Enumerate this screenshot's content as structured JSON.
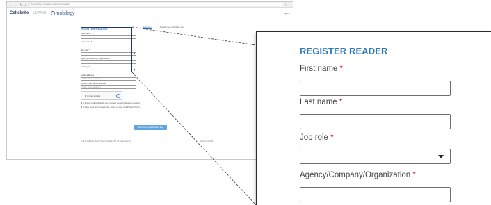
{
  "browser": {
    "url": "Secure  https://celebrite-learn.com/register",
    "nav_back": "←",
    "nav_forward": "→",
    "nav_reload": "C",
    "nav_home": "⌂",
    "tools": "☆ ⋮"
  },
  "site_header": {
    "brand": "Cellebrite",
    "brand_learn": "LEARN",
    "product": "mobilogy",
    "signin": "Sign in"
  },
  "mini_tabs": {
    "tab1": "New user",
    "tab2": "Already has activation key"
  },
  "mini_form": {
    "title": "REGISTER READER",
    "first_name": "First name *",
    "last_name": "Last name *",
    "job_role": "Job role *",
    "agency": "Agency/Company/Organization *",
    "country": "Country *",
    "email": "Email address *",
    "email_placeholder": "Enter email address",
    "confirm_email": "Confirm your email address *",
    "confirm_placeholder": "Enter email address",
    "captcha_label": "I'm not a robot",
    "captcha_brand": "reCAPTCHA",
    "consent1": "I accept that Cellebrite may contact me with relevant updates",
    "consent2": "I have read and agree to the Terms of Use and Privacy Policy",
    "submit": "Send me my activation key",
    "footer_left": "© 2018 Cellebrite Mobile Synchronization LTD. All rights reserved.",
    "footer_right": "Version 2018.06"
  },
  "zoom": {
    "title": "REGISTER READER",
    "first_name": "First name",
    "last_name": "Last name",
    "job_role": "Job role",
    "agency": "Agency/Company/Organization",
    "required_mark": "*"
  },
  "colors": {
    "accent": "#2f7bc1",
    "required": "#d0021b",
    "button": "#5fa4df"
  }
}
